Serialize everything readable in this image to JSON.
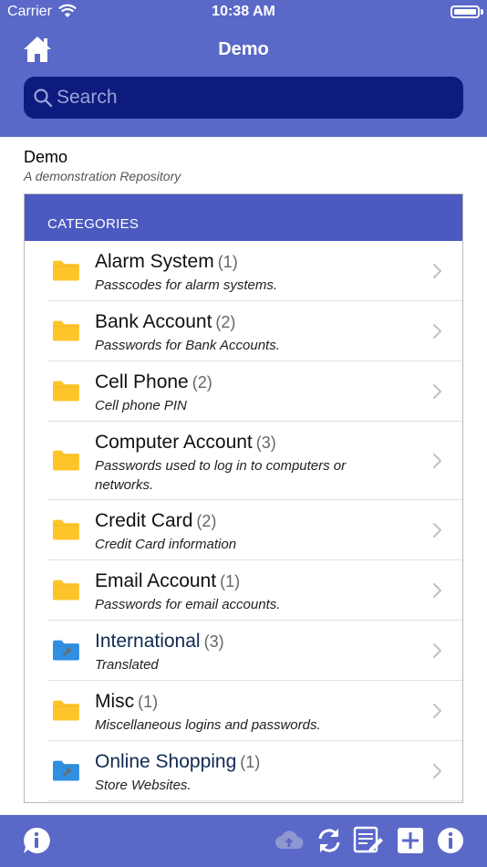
{
  "status_bar": {
    "carrier": "Carrier",
    "time": "10:38 AM"
  },
  "header": {
    "title": "Demo",
    "home_icon": "home-icon"
  },
  "search": {
    "placeholder": "Search"
  },
  "repository": {
    "name": "Demo",
    "description": "A demonstration Repository"
  },
  "categories_section": {
    "header": "CATEGORIES",
    "items": [
      {
        "name": "Alarm System",
        "count": "(1)",
        "description": "Passcodes for alarm systems.",
        "icon": "folder-yellow"
      },
      {
        "name": "Bank Account",
        "count": "(2)",
        "description": "Passwords for Bank Accounts.",
        "icon": "folder-yellow"
      },
      {
        "name": "Cell Phone",
        "count": "(2)",
        "description": "Cell phone PIN",
        "icon": "folder-yellow"
      },
      {
        "name": "Computer Account",
        "count": "(3)",
        "description": "Passwords used to log in to computers or networks.",
        "icon": "folder-yellow"
      },
      {
        "name": "Credit Card",
        "count": "(2)",
        "description": "Credit Card information",
        "icon": "folder-yellow"
      },
      {
        "name": "Email Account",
        "count": "(1)",
        "description": "Passwords for email accounts.",
        "icon": "folder-yellow"
      },
      {
        "name": "International",
        "count": "(3)",
        "description": "Translated",
        "icon": "folder-blue-wrench"
      },
      {
        "name": "Misc",
        "count": "(1)",
        "description": "Miscellaneous logins and passwords.",
        "icon": "folder-yellow"
      },
      {
        "name": "Online Shopping",
        "count": "(1)",
        "description": "Store Websites.",
        "icon": "folder-blue-wrench"
      }
    ]
  },
  "toolbar": {
    "icons": [
      "chat-info-icon",
      "cloud-upload-icon",
      "sync-icon",
      "edit-list-icon",
      "add-icon",
      "info-icon"
    ]
  },
  "colors": {
    "nav_bg": "#5a68c8",
    "search_bg": "#0d1b7e",
    "section_header_bg": "#4b59c0",
    "folder_yellow": "#fdc52a",
    "folder_blue": "#2f8fe0"
  }
}
